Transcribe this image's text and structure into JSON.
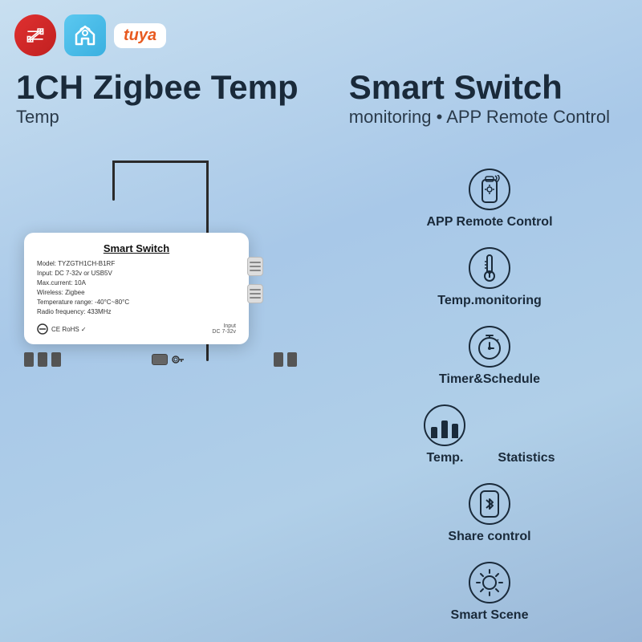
{
  "logos": {
    "tuya_text": "tuya",
    "zigbee_alt": "Zigbee",
    "home_alt": "Smart Home"
  },
  "title": {
    "line1_left": "1CH Zigbee Temp",
    "line1_right": "Smart Switch",
    "line2": "Temp monitoring • APP Remote Control"
  },
  "device": {
    "name": "Smart Switch",
    "model": "Model: TYZGTH1CH-B1RF",
    "input": "Input: DC 7-32v or USB5V",
    "current": "Max.current: 10A",
    "wireless": "Wireless: Zigbee",
    "temp_range": "Temperature range: -40°C~80°C",
    "radio": "Radio frequency: 433MHz",
    "cert": "CE RoHS ✓",
    "input_label": "Input",
    "input_voltage": "DC 7-32v"
  },
  "features": [
    {
      "id": "app-remote",
      "icon": "remote-icon",
      "label": "APP Remote Control"
    },
    {
      "id": "temp-monitoring",
      "icon": "thermometer-icon",
      "label": "Temp.monitoring"
    },
    {
      "id": "timer",
      "icon": "timer-icon",
      "label": "Timer&Schedule"
    },
    {
      "id": "statistics",
      "icon": "chart-icon",
      "label_left": "Temp.",
      "label_right": "Statistics"
    },
    {
      "id": "share",
      "icon": "bluetooth-icon",
      "label": "Share control"
    },
    {
      "id": "scene",
      "icon": "scene-icon",
      "label": "Smart Scene"
    }
  ],
  "colors": {
    "background_start": "#c8dff0",
    "background_end": "#9ab8d8",
    "title_dark": "#1a2a3a",
    "accent_orange": "#e85a20"
  }
}
